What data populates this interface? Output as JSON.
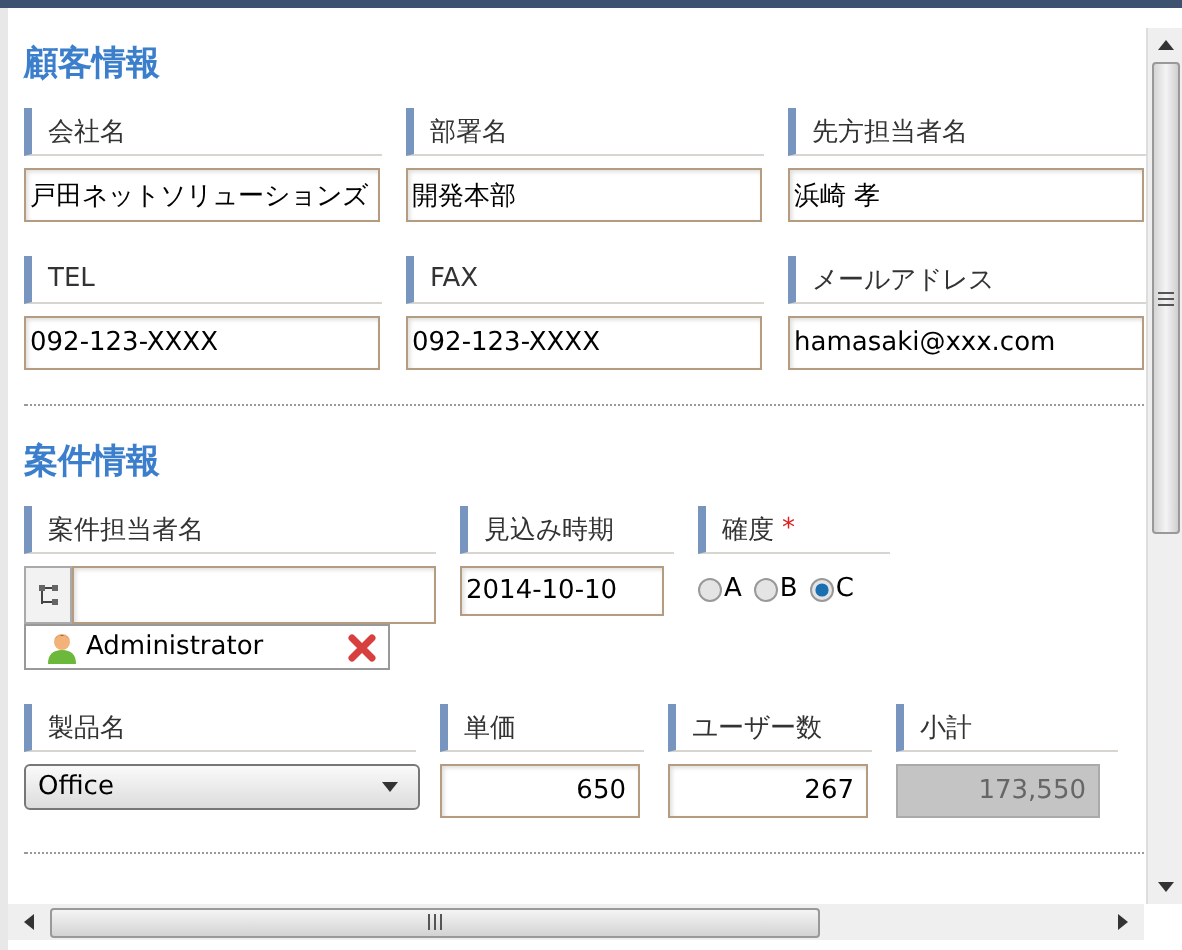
{
  "sections": [
    {
      "title": "顧客情報",
      "rows": [
        [
          {
            "kind": "text",
            "label": "会社名",
            "value": "戸田ネットソリューションズ"
          },
          {
            "kind": "text",
            "label": "部署名",
            "value": "開発本部"
          },
          {
            "kind": "text",
            "label": "先方担当者名",
            "value": "浜崎 孝"
          }
        ],
        [
          {
            "kind": "text",
            "label": "TEL",
            "value": "092-123-XXXX"
          },
          {
            "kind": "text",
            "label": "FAX",
            "value": "092-123-XXXX"
          },
          {
            "kind": "text",
            "label": "メールアドレス",
            "value": "hamasaki@xxx.com"
          }
        ]
      ]
    },
    {
      "title": "案件情報",
      "rows": [
        [
          {
            "kind": "picker",
            "label": "案件担当者名",
            "chips": [
              "Administrator"
            ]
          },
          {
            "kind": "date",
            "label": "見込み時期",
            "value": "2014-10-10"
          },
          {
            "kind": "radio",
            "label": "確度",
            "required_mark": "*",
            "options": [
              {
                "label": "A",
                "selected": false
              },
              {
                "label": "B",
                "selected": false
              },
              {
                "label": "C",
                "selected": true
              }
            ]
          }
        ],
        [
          {
            "kind": "select",
            "label": "製品名",
            "value": "Office"
          },
          {
            "kind": "number",
            "label": "単価",
            "value": "650"
          },
          {
            "kind": "number",
            "label": "ユーザー数",
            "value": "267"
          },
          {
            "kind": "readonly",
            "label": "小計",
            "value": "173,550"
          }
        ]
      ]
    }
  ]
}
